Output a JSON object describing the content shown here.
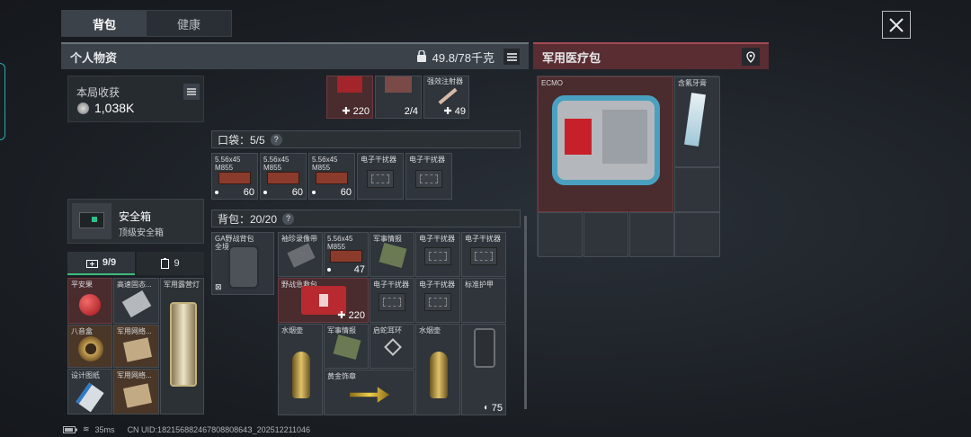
{
  "tabs": [
    "背包",
    "健康"
  ],
  "left_panel": {
    "title": "个人物资",
    "weight": "49.8/78千克"
  },
  "right_panel": {
    "title": "军用医疗包",
    "items": [
      "ECMO",
      "含氟牙膏"
    ]
  },
  "left_col": {
    "earnings_label": "本局收获",
    "earnings_value": "1,038K",
    "safe_title": "安全箱",
    "safe_subtitle": "顶级安全箱",
    "safe_tabs": [
      "9/9",
      "9"
    ]
  },
  "safe_items": [
    "平安果",
    "高速固态...",
    "军用露营灯",
    "八音盒",
    "军用网络...",
    "设计图纸",
    "军用网络..."
  ],
  "mid": {
    "top_counts": [
      "✚ 220",
      "2/4",
      "✚ 49"
    ],
    "top_label": "强效注射器",
    "pocket_label": "口袋：5/5",
    "pocket_items": [
      "5.56x45\nM855",
      "5.56x45\nM855",
      "5.56x45\nM855",
      "电子干扰器",
      "电子干扰器"
    ],
    "pocket_counts": [
      "60",
      "60",
      "60"
    ],
    "backpack_label": "背包：20/20",
    "equipped_backpack": "GA野战背包\n全境..."
  },
  "bp": [
    "袖珍录像带",
    "5.56x45\nM855",
    "军事情报",
    "电子干扰器",
    "电子干扰器",
    "野战急救包",
    "电子干扰器",
    "电子干扰器",
    "标准护甲",
    "水烟壶",
    "军事情报",
    "启蛇耳环",
    "水烟壶",
    "黄金饰章"
  ],
  "bp_counts": [
    "47",
    "✚ 220",
    "75"
  ],
  "status": {
    "ping": "35ms",
    "uid": "CN UID:18215688246780880864З_202512211046"
  }
}
